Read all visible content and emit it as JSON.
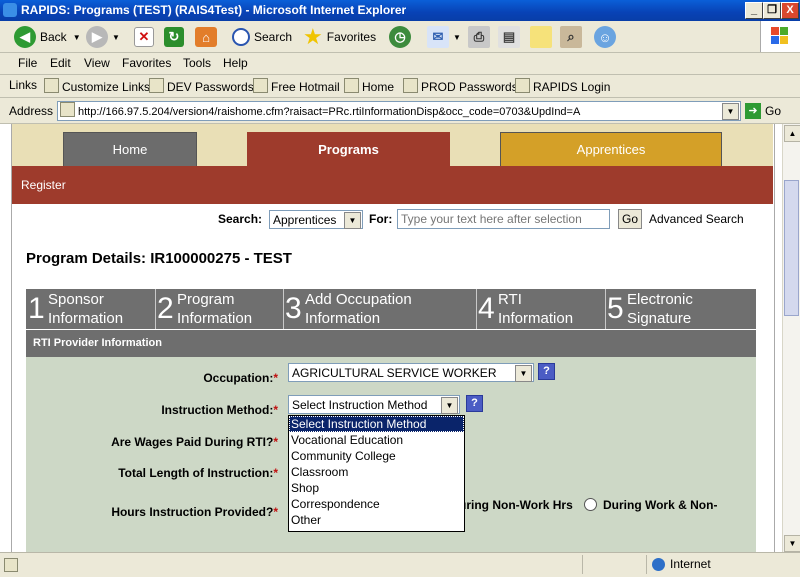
{
  "window": {
    "title": "RAPIDS: Programs  (TEST) (RAIS4Test) - Microsoft Internet Explorer",
    "minimize": "_",
    "maximize": "❐",
    "close": "X"
  },
  "toolbar": {
    "back_label": "Back",
    "search_label": "Search",
    "favorites_label": "Favorites"
  },
  "menu": {
    "items": [
      "File",
      "Edit",
      "View",
      "Favorites",
      "Tools",
      "Help"
    ]
  },
  "links": {
    "label": "Links",
    "items": [
      "Customize Links",
      "DEV Passwords",
      "Free Hotmail",
      "Home",
      "PROD Passwords",
      "RAPIDS Login"
    ]
  },
  "address": {
    "label": "Address",
    "url": "http://166.97.5.204/version4/raishome.cfm?raisact=PRc.rtiInformationDisp&occ_code=0703&UpdInd=A",
    "go_label": "Go"
  },
  "tabs": {
    "home": "Home",
    "programs": "Programs",
    "apprentices": "Apprentices"
  },
  "subnav": {
    "register": "Register"
  },
  "search": {
    "label": "Search:",
    "selected": "Apprentices",
    "for_label": "For:",
    "placeholder": "Type your text here after selection",
    "go_label": "Go",
    "advanced_label": "Advanced Search"
  },
  "page_title": "Program Details: IR100000275 - TEST",
  "steps": [
    {
      "num": "1",
      "line1": "Sponsor",
      "line2": "Information"
    },
    {
      "num": "2",
      "line1": "Program",
      "line2": "Information"
    },
    {
      "num": "3",
      "line1": "Add Occupation",
      "line2": "Information"
    },
    {
      "num": "4",
      "line1": "RTI",
      "line2": "Information"
    },
    {
      "num": "5",
      "line1": "Electronic",
      "line2": "Signature"
    }
  ],
  "section_header": "RTI Provider Information",
  "form": {
    "occupation_label": "Occupation:",
    "occupation_value": "AGRICULTURAL SERVICE WORKER",
    "method_label": "Instruction Method:",
    "method_value": "Select Instruction Method",
    "wages_label": "Are Wages Paid During RTI?",
    "length_label": "Total Length of Instruction:",
    "hours_label": "Hours Instruction Provided?",
    "hours_option_a": "uring Non-Work Hrs",
    "hours_option_b": "During Work & Non-",
    "required_mark": "*",
    "help_mark": "?"
  },
  "dropdown": {
    "options": [
      "Select Instruction Method",
      "Vocational Education",
      "Community College",
      "Classroom",
      "Shop",
      "Correspondence",
      "Other"
    ],
    "selected_index": 0
  },
  "status": {
    "zone": "Internet"
  },
  "colors": {
    "programs_tab": "#9e3b2c",
    "home_tab": "#6c6c6c",
    "apprentices_tab": "#d4a028",
    "subnav": "#9e3b2c",
    "steps_bg": "#6f6f6f",
    "section_bg": "#6e6e6e",
    "form_bg": "#cdd8c6"
  }
}
